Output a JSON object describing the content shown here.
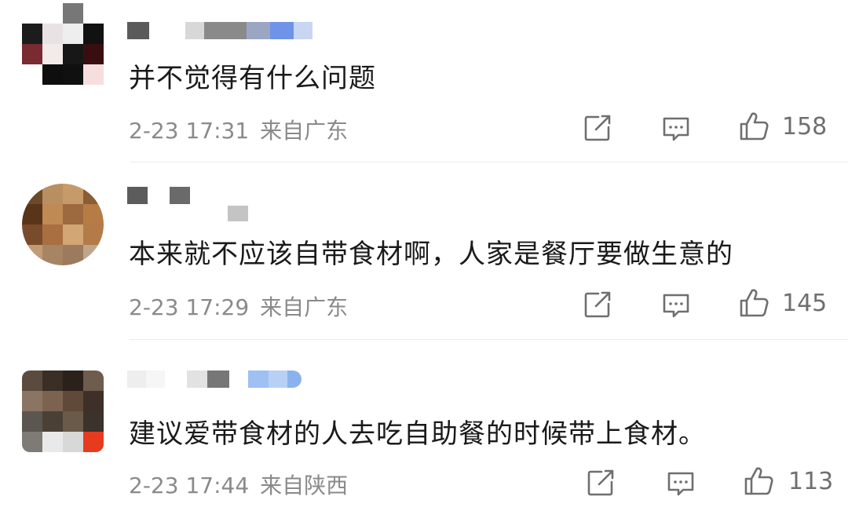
{
  "comments": [
    {
      "text": "并不觉得有什么问题",
      "time": "2-23 17:31",
      "location": "来自广东",
      "likes": "158"
    },
    {
      "text": "本来就不应该自带食材啊，人家是餐厅要做生意的",
      "time": "2-23 17:29",
      "location": "来自广东",
      "likes": "145"
    },
    {
      "text": "建议爱带食材的人去吃自助餐的时候带上食材。",
      "time": "2-23 17:44",
      "location": "来自陕西",
      "likes": "113"
    }
  ],
  "icons": {
    "share": "share-icon",
    "reply": "comment-icon",
    "like": "thumbs-up-icon"
  },
  "colors": {
    "text": "#1a1a1a",
    "meta": "#8a8a8a",
    "icon": "#6f6f6f",
    "divider": "#ececec"
  }
}
